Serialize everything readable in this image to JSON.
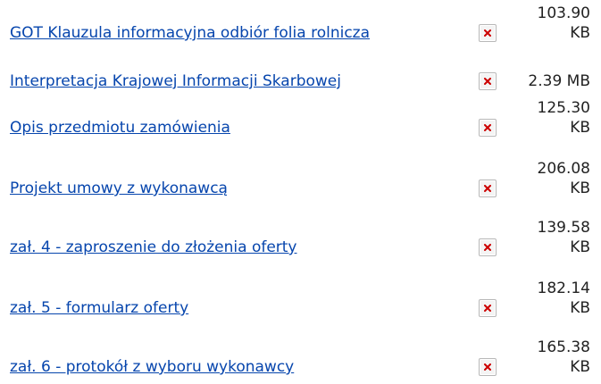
{
  "files": [
    {
      "name": "GOT Klauzula informacyjna odbiór folia rolnicza",
      "size_value": "103.90",
      "size_unit": "KB",
      "icon": "broken-image-icon"
    },
    {
      "name": "Interpretacja Krajowej Informacji Skarbowej",
      "size": "2.39 MB",
      "icon": "broken-image-icon"
    },
    {
      "name": "Opis przedmiotu zamówienia",
      "size_value": "125.30",
      "size_unit": "KB",
      "icon": "broken-image-icon"
    },
    {
      "name": "Projekt umowy z wykonawcą",
      "size_value": "206.08",
      "size_unit": "KB",
      "icon": "broken-image-icon"
    },
    {
      "name": "zał. 4 - zaproszenie do złożenia oferty",
      "size_value": "139.58",
      "size_unit": "KB",
      "icon": "broken-image-icon"
    },
    {
      "name": "zał. 5 - formularz oferty",
      "size_value": "182.14",
      "size_unit": "KB",
      "icon": "broken-image-icon"
    },
    {
      "name": "zał. 6 - protokół z wyboru wykonawcy",
      "size_value": "165.38",
      "size_unit": "KB",
      "icon": "broken-image-icon"
    }
  ],
  "colors": {
    "link": "#0645ad",
    "text": "#222222",
    "icon_x": "#cc0000",
    "icon_border": "#b8b8b8"
  }
}
